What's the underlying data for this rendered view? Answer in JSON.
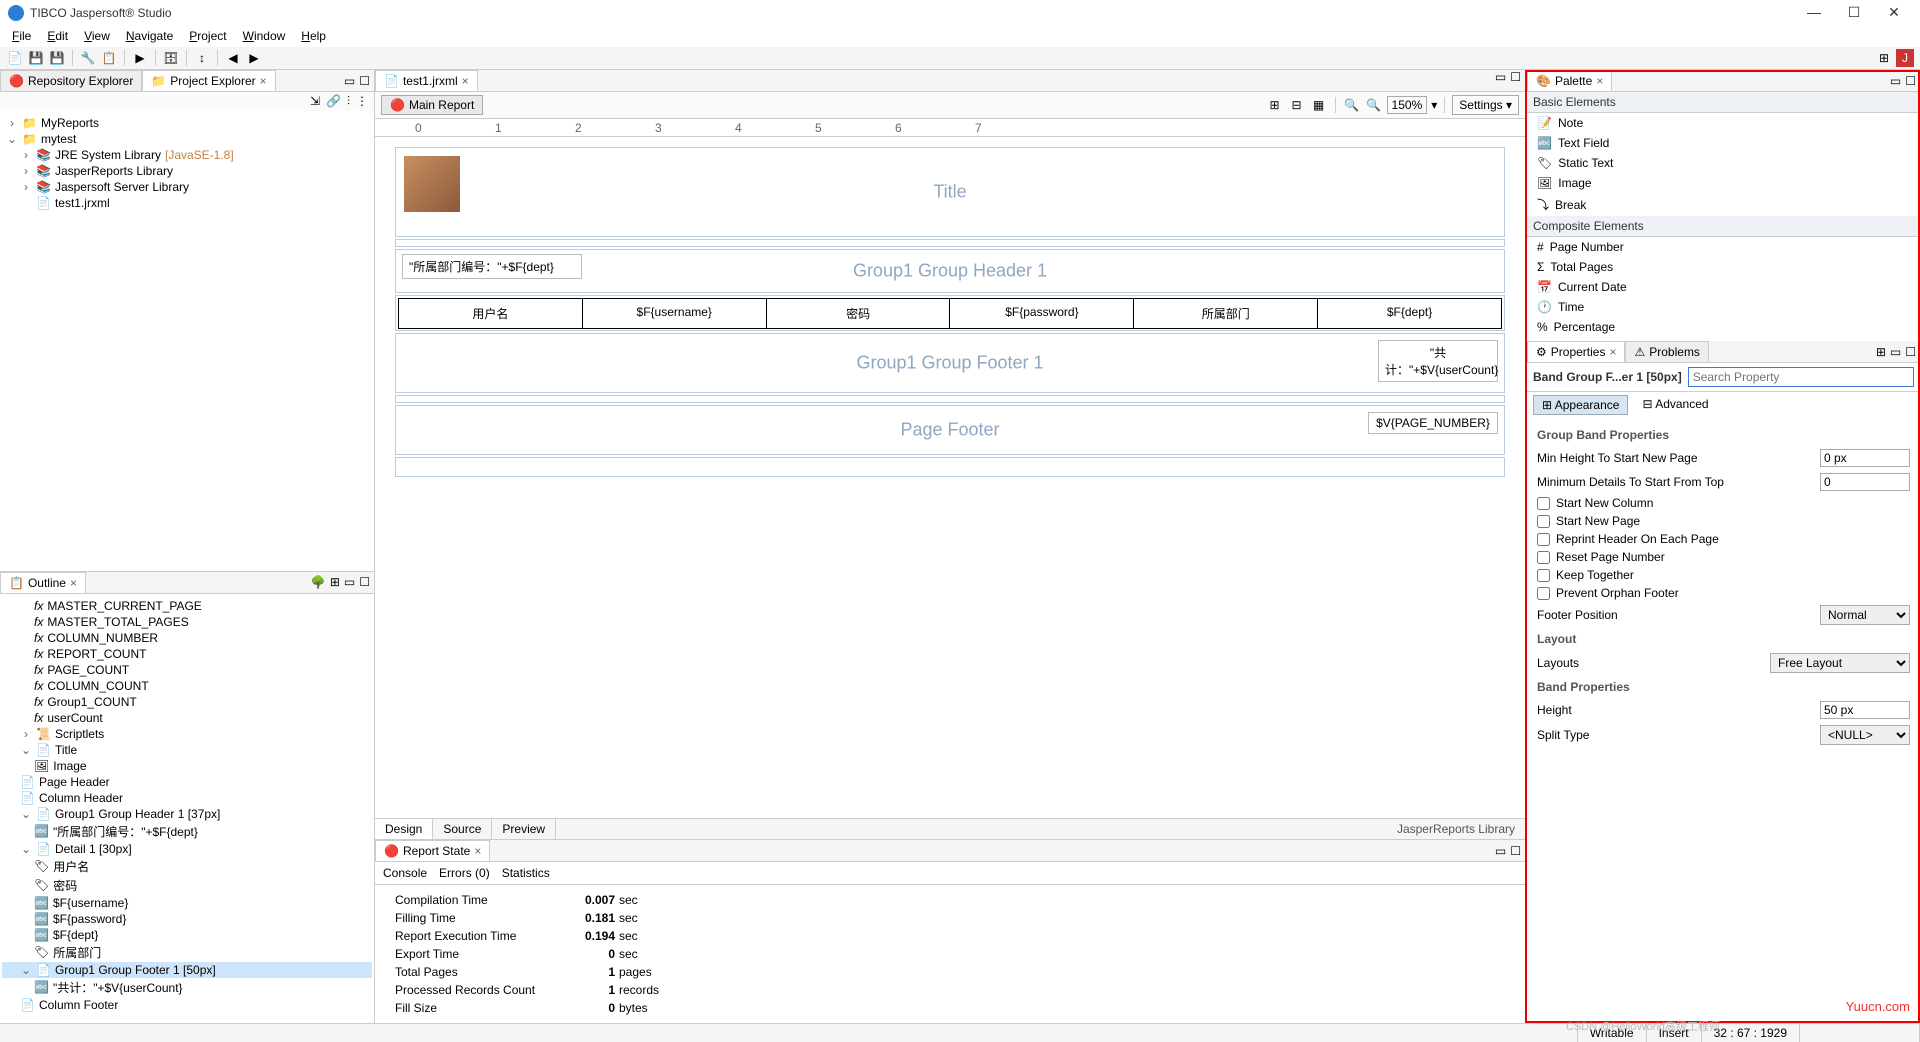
{
  "app": {
    "title": "TIBCO Jaspersoft® Studio"
  },
  "menu": [
    "File",
    "Edit",
    "View",
    "Navigate",
    "Project",
    "Window",
    "Help"
  ],
  "explorer": {
    "tabs": [
      "Repository Explorer",
      "Project Explorer"
    ],
    "items": {
      "myreports": "MyReports",
      "mytest": "mytest",
      "jre": "JRE System Library",
      "jre_ver": "[JavaSE-1.8]",
      "jr_lib": "JasperReports Library",
      "js_lib": "Jaspersoft Server Library",
      "file": "test1.jrxml"
    }
  },
  "outline": {
    "title": "Outline",
    "items": [
      "MASTER_CURRENT_PAGE",
      "MASTER_TOTAL_PAGES",
      "COLUMN_NUMBER",
      "REPORT_COUNT",
      "PAGE_COUNT",
      "COLUMN_COUNT",
      "Group1_COUNT",
      "userCount"
    ],
    "scriptlets": "Scriptlets",
    "title_node": "Title",
    "image_node": "Image",
    "page_header": "Page Header",
    "col_header": "Column Header",
    "grp_header": "Group1 Group Header 1 [37px]",
    "grp_header_txt": "\"所属部门编号：\"+$F{dept}",
    "detail": "Detail 1 [30px]",
    "d1": "用户名",
    "d2": "密码",
    "d3": "$F{username}",
    "d4": "$F{password}",
    "d5": "$F{dept}",
    "d6": "所属部门",
    "grp_footer": "Group1 Group Footer 1 [50px]",
    "grp_footer_txt": "\"共计：\"+$V{userCount}",
    "col_footer": "Column Footer"
  },
  "editor": {
    "tab": "test1.jrxml",
    "main_report": "Main Report",
    "zoom": "150%",
    "settings": "Settings",
    "bottom_tabs": [
      "Design",
      "Source",
      "Preview"
    ],
    "jr_label": "JasperReports Library"
  },
  "canvas": {
    "title_band": "Title",
    "dept_expr": "\"所属部门编号：\"+$F{dept}",
    "grp_hdr": "Group1 Group Header 1",
    "cols": [
      "用户名",
      "$F{username}",
      "密码",
      "$F{password}",
      "所属部门",
      "$F{dept}"
    ],
    "detail_label": "Detail 1",
    "grp_ftr": "Group1 Group Footer 1",
    "sum_expr": "\"共计：\"+$V{userCount}",
    "page_ftr": "Page Footer",
    "page_num": "$V{PAGE_NUMBER}"
  },
  "report_state": {
    "tab": "Report State",
    "sub_tabs": [
      "Console",
      "Errors (0)",
      "Statistics"
    ],
    "rows": [
      {
        "l": "Compilation Time",
        "v": "0.007",
        "u": "sec"
      },
      {
        "l": "Filling Time",
        "v": "0.181",
        "u": "sec"
      },
      {
        "l": "Report Execution Time",
        "v": "0.194",
        "u": "sec"
      },
      {
        "l": "Export Time",
        "v": "0",
        "u": "sec"
      },
      {
        "l": "Total Pages",
        "v": "1",
        "u": "pages"
      },
      {
        "l": "Processed Records Count",
        "v": "1",
        "u": "records"
      },
      {
        "l": "Fill Size",
        "v": "0",
        "u": "bytes"
      }
    ]
  },
  "palette": {
    "title": "Palette",
    "basic": "Basic Elements",
    "basic_items": [
      "Note",
      "Text Field",
      "Static Text",
      "Image",
      "Break"
    ],
    "composite": "Composite Elements",
    "comp_items": [
      "Page Number",
      "Total Pages",
      "Current Date",
      "Time",
      "Percentage"
    ]
  },
  "props": {
    "tab1": "Properties",
    "tab2": "Problems",
    "title": "Band Group F...er 1 [50px]",
    "search_ph": "Search Property",
    "tabs": [
      "Appearance",
      "Advanced"
    ],
    "group_band": "Group Band Properties",
    "min_height": "Min Height To Start New Page",
    "min_height_v": "0 px",
    "min_details": "Minimum Details To Start From Top",
    "min_details_v": "0",
    "chks": [
      "Start New Column",
      "Start New Page",
      "Reprint Header On Each Page",
      "Reset Page Number",
      "Keep Together",
      "Prevent Orphan Footer"
    ],
    "footer_pos": "Footer Position",
    "footer_pos_v": "Normal",
    "layout_hdr": "Layout",
    "layouts": "Layouts",
    "layouts_v": "Free Layout",
    "band_props": "Band Properties",
    "height": "Height",
    "height_v": "50 px",
    "split": "Split Type",
    "split_v": "<NULL>"
  },
  "status": {
    "writable": "Writable",
    "insert": "Insert",
    "pos": "32 : 67 : 1929"
  },
  "watermark": "Yuucn.com",
  "watermark2": "CSDN @HelloWorld高级工程师"
}
